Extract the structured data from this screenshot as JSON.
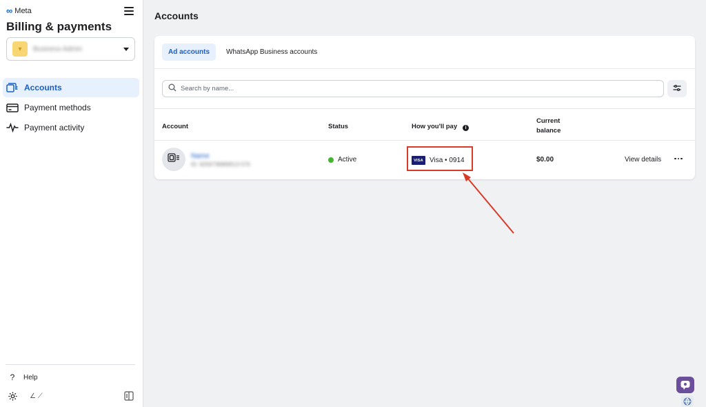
{
  "sidebar": {
    "brand": "Meta",
    "title": "Billing & payments",
    "account_selector": {
      "name": "Business Admin"
    },
    "nav": [
      {
        "label": "Accounts",
        "active": true
      },
      {
        "label": "Payment methods",
        "active": false
      },
      {
        "label": "Payment activity",
        "active": false
      }
    ],
    "help_label": "Help"
  },
  "main": {
    "title": "Accounts",
    "tabs": [
      {
        "label": "Ad accounts",
        "active": true
      },
      {
        "label": "WhatsApp Business accounts",
        "active": false
      }
    ],
    "search": {
      "placeholder": "Search by name..."
    },
    "table": {
      "headers": {
        "account": "Account",
        "status": "Status",
        "pay": "How you'll pay",
        "balance_line1": "Current",
        "balance_line2": "balance"
      },
      "rows": [
        {
          "name": "Name",
          "id": "ID: 9259736869513 570",
          "status": "Active",
          "status_color": "#44b52f",
          "card_brand": "VISA",
          "payment": "Visa • 0914",
          "balance": "$0.00",
          "action": "View details"
        }
      ]
    }
  },
  "annotation": {
    "color": "#d93a28",
    "target": "payment-method-cell"
  },
  "colors": {
    "accent": "#1a5fc7",
    "active_bg": "#e7f0fd",
    "page_bg": "#f0f1f3"
  }
}
